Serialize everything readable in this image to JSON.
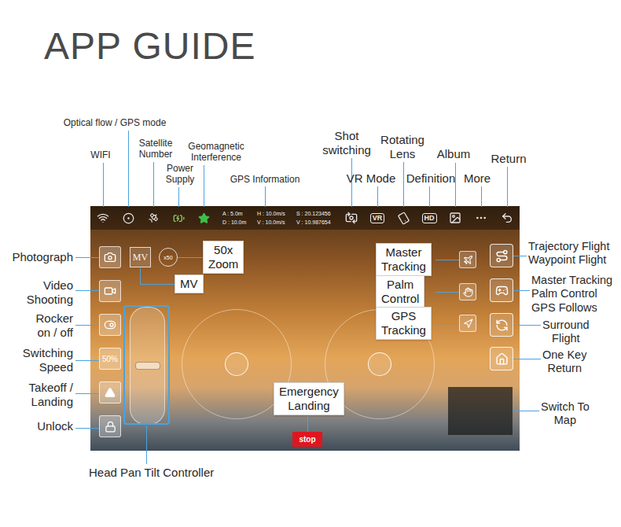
{
  "title": "APP GUIDE",
  "top_callouts": [
    "WIFI",
    "Optical flow / GPS mode",
    "Satellite\nNumber",
    "Power\nSupply",
    "Geomagnetic\nInterference",
    "GPS Information",
    "Shot\nswitching",
    "VR Mode",
    "Rotating\nLens",
    "Definition",
    "Album",
    "More",
    "Return"
  ],
  "left_callouts": [
    "Photograph",
    "Video\nShooting",
    "Rocker\non / off",
    "Switching\nSpeed",
    "Takeoff /\nLanding",
    "Unlock"
  ],
  "right_callouts": [
    "Trajectory Flight\nWaypoint Flight",
    "Master Tracking\nPalm Control\nGPS Follows",
    "Surround\nFlight",
    "One Key\nReturn",
    "Switch To\nMap"
  ],
  "tracking_callouts": [
    "Master\nTracking",
    "Palm\nControl",
    "GPS\nTracking"
  ],
  "zoom_callout": "50x\nZoom",
  "mv_callout": "MV",
  "emergency_callout": "Emergency\nLanding",
  "gimbal_callout": "Head Pan Tilt Controller",
  "screen": {
    "gps_info": [
      "A : 5.0m",
      "H : 10.0m/s",
      "S : 20.123456",
      "D : 10.0m",
      "V : 10.0m/s",
      "V : 10.987654"
    ],
    "vr_badge": "VR",
    "hd_badge": "HD",
    "mv_button": "MV",
    "zoom_button": "x50",
    "speed_button": "50%",
    "stop_button": "stop"
  }
}
